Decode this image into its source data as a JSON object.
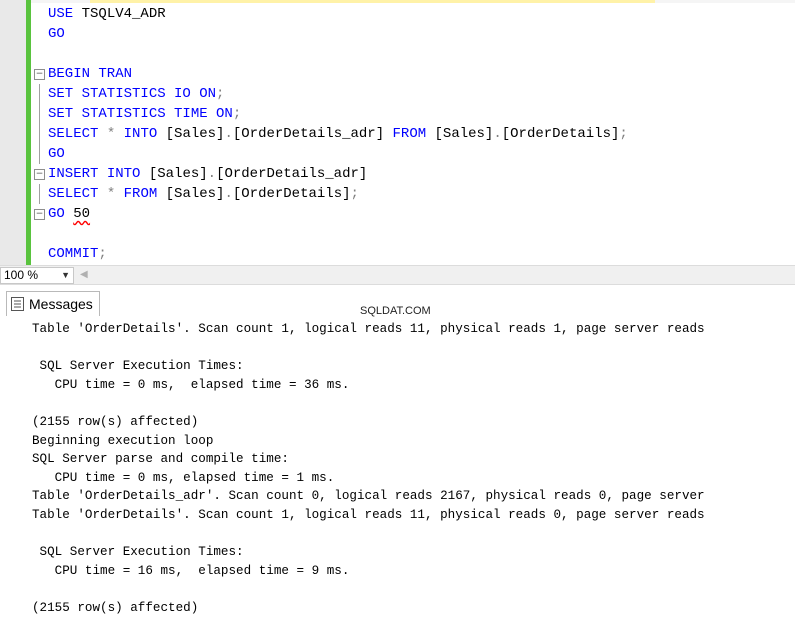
{
  "editor": {
    "lines": [
      {
        "parts": [
          {
            "t": "USE",
            "c": "kw"
          },
          {
            "t": " TSQLV4_ADR",
            "c": "tx"
          }
        ]
      },
      {
        "parts": [
          {
            "t": "GO",
            "c": "kw"
          }
        ]
      },
      {
        "parts": []
      },
      {
        "parts": [
          {
            "t": "BEGIN TRAN",
            "c": "kw"
          }
        ],
        "fold": "open"
      },
      {
        "parts": [
          {
            "t": "SET STATISTICS IO ON",
            "c": "kw"
          },
          {
            "t": ";",
            "c": "gr"
          }
        ],
        "foldline": true
      },
      {
        "parts": [
          {
            "t": "SET STATISTICS TIME ON",
            "c": "kw"
          },
          {
            "t": ";",
            "c": "gr"
          }
        ],
        "foldline": true
      },
      {
        "parts": [
          {
            "t": "SELECT",
            "c": "kw"
          },
          {
            "t": " * ",
            "c": "gr"
          },
          {
            "t": "INTO",
            "c": "kw"
          },
          {
            "t": " [Sales]",
            "c": "tx"
          },
          {
            "t": ".",
            "c": "gr"
          },
          {
            "t": "[OrderDetails_adr] ",
            "c": "tx"
          },
          {
            "t": "FROM",
            "c": "kw"
          },
          {
            "t": " [Sales]",
            "c": "tx"
          },
          {
            "t": ".",
            "c": "gr"
          },
          {
            "t": "[OrderDetails]",
            "c": "tx"
          },
          {
            "t": ";",
            "c": "gr"
          }
        ],
        "foldline": true
      },
      {
        "parts": [
          {
            "t": "GO",
            "c": "kw"
          }
        ],
        "foldline": true
      },
      {
        "parts": [
          {
            "t": "INSERT",
            "c": "kw"
          },
          {
            "t": " ",
            "c": "tx"
          },
          {
            "t": "INTO",
            "c": "kw"
          },
          {
            "t": " [Sales]",
            "c": "tx"
          },
          {
            "t": ".",
            "c": "gr"
          },
          {
            "t": "[OrderDetails_adr]",
            "c": "tx"
          }
        ],
        "fold": "open"
      },
      {
        "parts": [
          {
            "t": "SELECT",
            "c": "kw"
          },
          {
            "t": " * ",
            "c": "gr"
          },
          {
            "t": "FROM",
            "c": "kw"
          },
          {
            "t": " [Sales]",
            "c": "tx"
          },
          {
            "t": ".",
            "c": "gr"
          },
          {
            "t": "[OrderDetails]",
            "c": "tx"
          },
          {
            "t": ";",
            "c": "gr"
          }
        ],
        "foldline": true
      },
      {
        "parts": [
          {
            "t": "GO",
            "c": "kw"
          },
          {
            "t": " ",
            "c": "tx"
          },
          {
            "t": "50",
            "c": "tx squiggle"
          }
        ],
        "fold": "open"
      },
      {
        "parts": []
      },
      {
        "parts": [
          {
            "t": "COMMIT",
            "c": "kw"
          },
          {
            "t": ";",
            "c": "gr"
          }
        ]
      }
    ]
  },
  "zoom": {
    "value": "100 %"
  },
  "tabs": {
    "messages_label": "Messages"
  },
  "watermark": "SQLDAT.COM",
  "output": [
    "Table 'OrderDetails'. Scan count 1, logical reads 11, physical reads 1, page server reads",
    "",
    " SQL Server Execution Times:",
    "   CPU time = 0 ms,  elapsed time = 36 ms.",
    "",
    "(2155 row(s) affected)",
    "Beginning execution loop",
    "SQL Server parse and compile time:",
    "   CPU time = 0 ms, elapsed time = 1 ms.",
    "Table 'OrderDetails_adr'. Scan count 0, logical reads 2167, physical reads 0, page server",
    "Table 'OrderDetails'. Scan count 1, logical reads 11, physical reads 0, page server reads",
    "",
    " SQL Server Execution Times:",
    "   CPU time = 16 ms,  elapsed time = 9 ms.",
    "",
    "(2155 row(s) affected)"
  ]
}
